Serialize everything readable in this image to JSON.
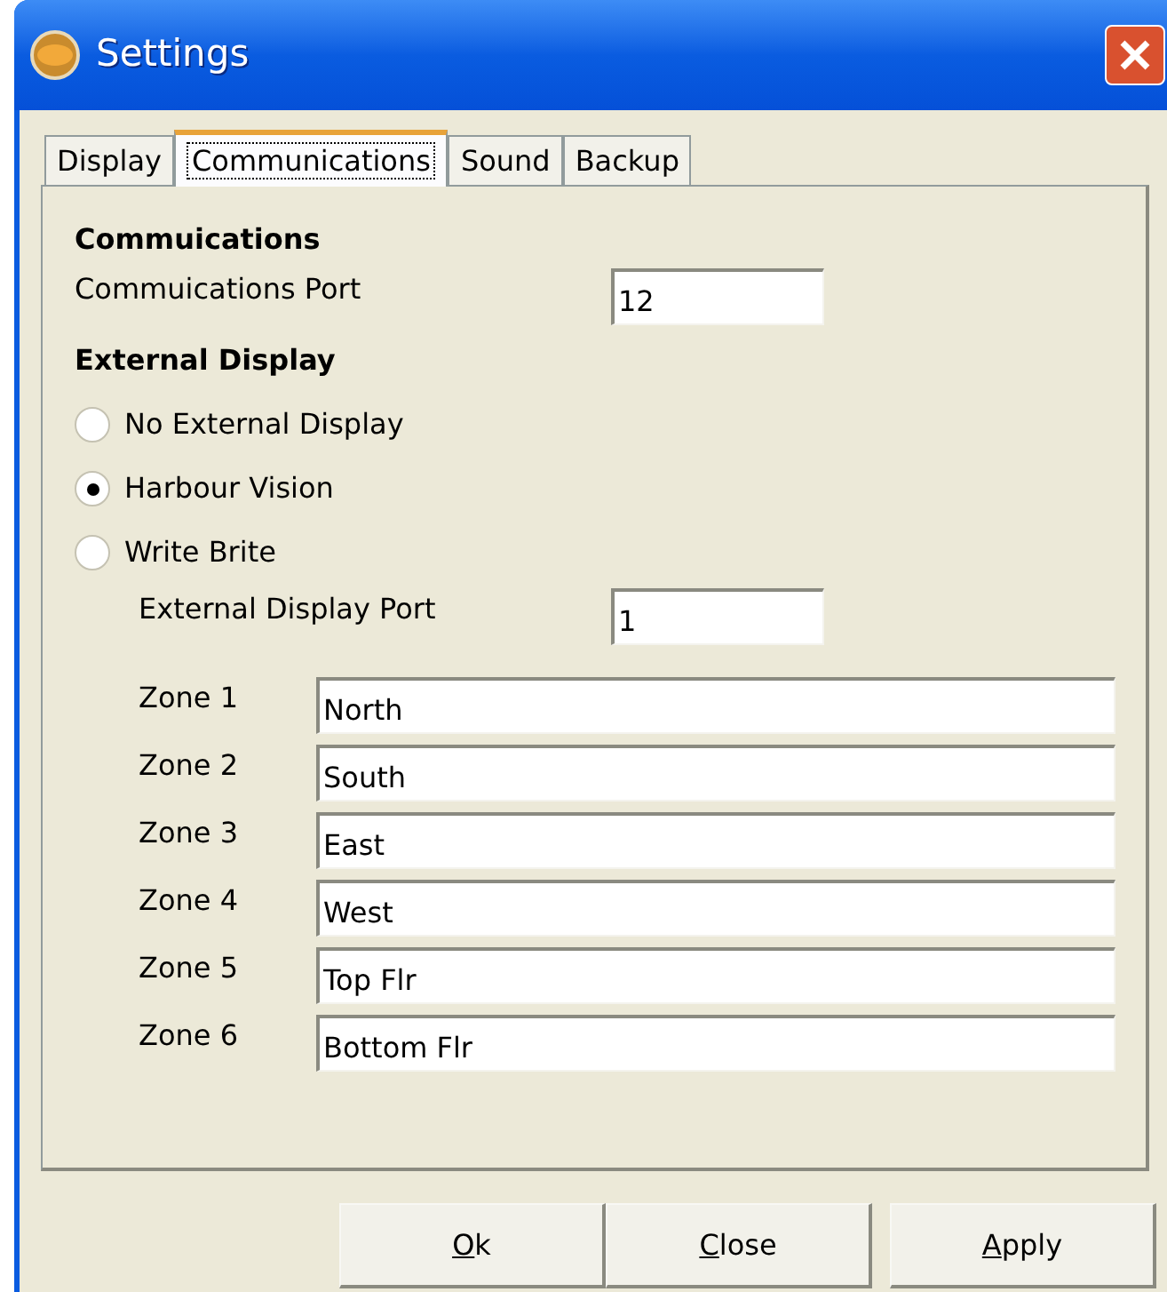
{
  "window": {
    "title": "Settings"
  },
  "tabs": [
    {
      "label": "Display",
      "selected": false
    },
    {
      "label": "Communications",
      "selected": true
    },
    {
      "label": "Sound",
      "selected": false
    },
    {
      "label": "Backup",
      "selected": false
    }
  ],
  "communications": {
    "heading": "Commuications",
    "port_label": "Commuications Port",
    "port_value": "12"
  },
  "external_display": {
    "heading": "External Display",
    "options": [
      {
        "label": "No External Display",
        "selected": false
      },
      {
        "label": "Harbour Vision",
        "selected": true
      },
      {
        "label": "Write Brite",
        "selected": false
      }
    ],
    "port_label": "External Display Port",
    "port_value": "1",
    "zones": [
      {
        "label": "Zone 1",
        "value": "North"
      },
      {
        "label": "Zone 2",
        "value": "South"
      },
      {
        "label": "Zone 3",
        "value": "East"
      },
      {
        "label": "Zone 4",
        "value": "West"
      },
      {
        "label": "Zone 5",
        "value": "Top Flr"
      },
      {
        "label": "Zone 6",
        "value": "Bottom Flr"
      }
    ]
  },
  "buttons": [
    {
      "label": "Ok",
      "mnemonic": true
    },
    {
      "label": "Close",
      "mnemonic": true
    },
    {
      "label": "Apply",
      "mnemonic": true
    }
  ]
}
